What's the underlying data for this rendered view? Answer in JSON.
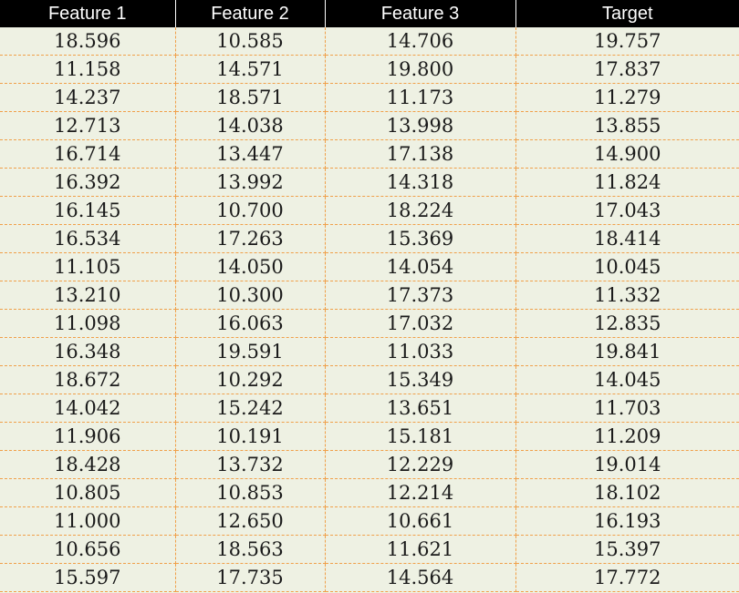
{
  "chart_data": {
    "type": "table",
    "columns": [
      "Feature 1",
      "Feature 2",
      "Feature 3",
      "Target"
    ],
    "rows": [
      [
        "18.596",
        "10.585",
        "14.706",
        "19.757"
      ],
      [
        "11.158",
        "14.571",
        "19.800",
        "17.837"
      ],
      [
        "14.237",
        "18.571",
        "11.173",
        "11.279"
      ],
      [
        "12.713",
        "14.038",
        "13.998",
        "13.855"
      ],
      [
        "16.714",
        "13.447",
        "17.138",
        "14.900"
      ],
      [
        "16.392",
        "13.992",
        "14.318",
        "11.824"
      ],
      [
        "16.145",
        "10.700",
        "18.224",
        "17.043"
      ],
      [
        "16.534",
        "17.263",
        "15.369",
        "18.414"
      ],
      [
        "11.105",
        "14.050",
        "14.054",
        "10.045"
      ],
      [
        "13.210",
        "10.300",
        "17.373",
        "11.332"
      ],
      [
        "11.098",
        "16.063",
        "17.032",
        "12.835"
      ],
      [
        "16.348",
        "19.591",
        "11.033",
        "19.841"
      ],
      [
        "18.672",
        "10.292",
        "15.349",
        "14.045"
      ],
      [
        "14.042",
        "15.242",
        "13.651",
        "11.703"
      ],
      [
        "11.906",
        "10.191",
        "15.181",
        "11.209"
      ],
      [
        "18.428",
        "13.732",
        "12.229",
        "19.014"
      ],
      [
        "10.805",
        "10.853",
        "12.214",
        "18.102"
      ],
      [
        "11.000",
        "12.650",
        "10.661",
        "16.193"
      ],
      [
        "10.656",
        "18.563",
        "11.621",
        "15.397"
      ],
      [
        "15.597",
        "17.735",
        "14.564",
        "17.772"
      ]
    ]
  },
  "colors": {
    "header_background": "#000000",
    "header_text": "#ffffff",
    "body_background": "#eef1e3",
    "grid_line": "#f0a04a",
    "cell_text": "#1a1a1a"
  }
}
